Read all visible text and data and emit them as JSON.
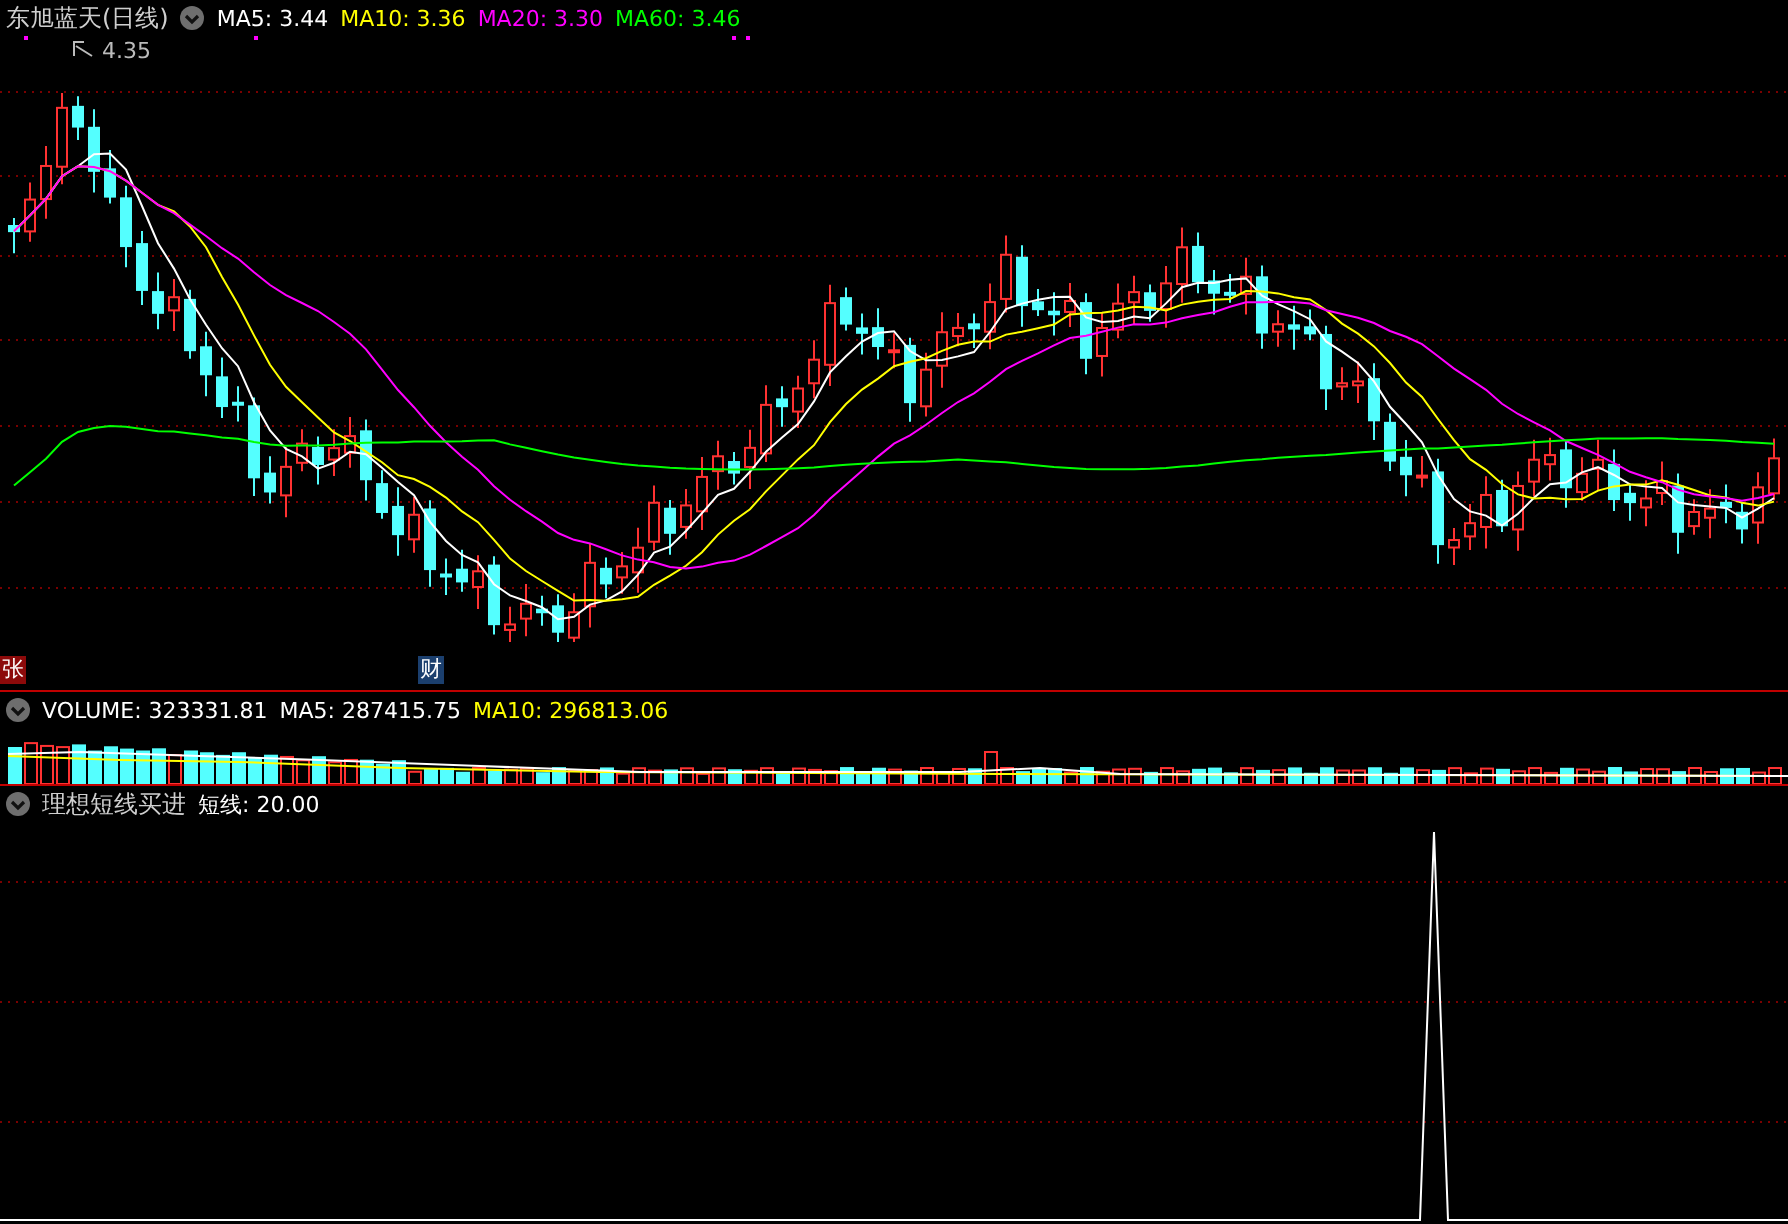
{
  "header": {
    "title": "东旭蓝天(日线)",
    "readouts": [
      {
        "label": "MA5: 3.44",
        "color": "#ffffff"
      },
      {
        "label": "MA10: 3.36",
        "color": "#ffff00"
      },
      {
        "label": "MA20: 3.30",
        "color": "#ff00ff"
      },
      {
        "label": "MA60: 3.46",
        "color": "#00ff00"
      }
    ]
  },
  "price_chart": {
    "high_label": "4.35"
  },
  "markers": [
    {
      "text": "张",
      "color": "#8c0a0a"
    },
    {
      "text": "财",
      "color": "#1b3f6e"
    }
  ],
  "volume": {
    "readouts": [
      {
        "label": "VOLUME: 323331.81",
        "color": "#ffffff"
      },
      {
        "label": "MA5: 287415.75",
        "color": "#ffffff"
      },
      {
        "label": "MA10: 296813.06",
        "color": "#ffff00"
      }
    ]
  },
  "indicator": {
    "title": "理想短线买进",
    "readouts": [
      {
        "label": "短线: 20.00",
        "color": "#ffffff"
      }
    ]
  }
}
